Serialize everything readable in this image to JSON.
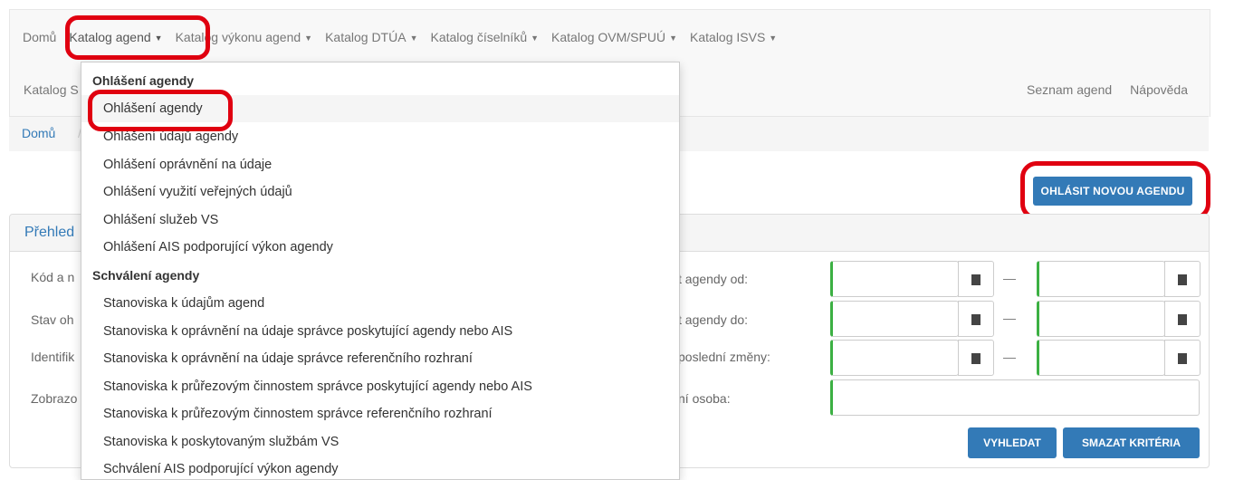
{
  "nav": {
    "items": [
      {
        "label": "Domů",
        "caret": false
      },
      {
        "label": "Katalog agend",
        "caret": true
      },
      {
        "label": "Katalog výkonu agend",
        "caret": true
      },
      {
        "label": "Katalog DTÚA",
        "caret": true
      },
      {
        "label": "Katalog číselníků",
        "caret": true
      },
      {
        "label": "Katalog OVM/SPUÚ",
        "caret": true
      },
      {
        "label": "Katalog ISVS",
        "caret": true
      }
    ],
    "row2_left": "Katalog S",
    "row2_right": [
      "Seznam agend",
      "Nápověda"
    ]
  },
  "breadcrumb": {
    "home": "Domů",
    "sep": "/"
  },
  "primary_button": "OHLÁSIT NOVOU AGENDU",
  "panel": {
    "title": "Přehled",
    "left_labels": [
      "Kód a n",
      "Stav oh",
      "Identifik",
      "Zobrazo"
    ],
    "right_labels": [
      "t agendy od:",
      "t agendy do:",
      "poslední změny:",
      "ní osoba:"
    ],
    "dash": "—",
    "search_button": "VYHLEDAT",
    "clear_button": "SMAZAT KRITÉRIA"
  },
  "dropdown": {
    "header1": "Ohlášení agendy",
    "group1": [
      "Ohlášení agendy",
      "Ohlášení údajů agendy",
      "Ohlášení oprávnění na údaje",
      "Ohlášení využití veřejných údajů",
      "Ohlášení služeb VS",
      "Ohlášení AIS podporující výkon agendy"
    ],
    "header2": "Schválení agendy",
    "group2": [
      "Stanoviska k údajům agend",
      "Stanoviska k oprávnění na údaje správce poskytující agendy nebo AIS",
      "Stanoviska k oprávnění na údaje správce referenčního rozhraní",
      "Stanoviska k průřezovým činnostem správce poskytující agendy nebo AIS",
      "Stanoviska k průřezovým činnostem správce referenčního rozhraní",
      "Stanoviska k poskytovaným službám VS",
      "Schválení AIS podporující výkon agendy"
    ]
  },
  "colors": {
    "highlight": "#e00010",
    "primary": "#337ab7",
    "valid": "#3cb043"
  },
  "icons": [
    "caret-down-icon",
    "calendar-icon"
  ]
}
